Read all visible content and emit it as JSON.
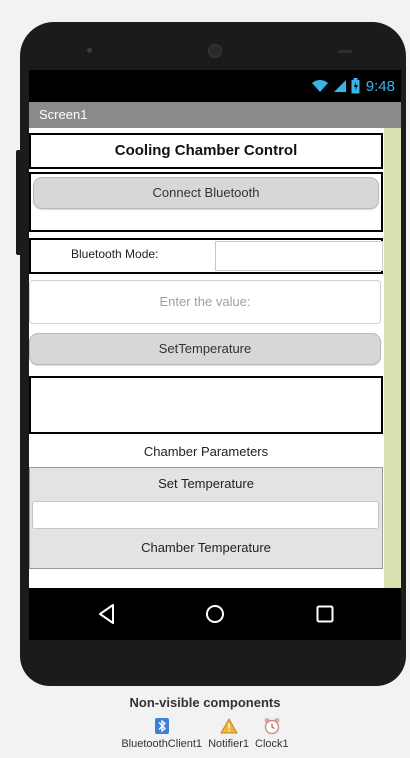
{
  "status_bar": {
    "time": "9:48",
    "icons": [
      "wifi-icon",
      "signal-icon",
      "battery-icon"
    ]
  },
  "screen": {
    "title": "Screen1"
  },
  "main": {
    "title": "Cooling Chamber Control",
    "connect_button": "Connect Bluetooth",
    "mode_label": "Bluetooth Mode:",
    "mode_value": "",
    "value_placeholder": "Enter the value:",
    "set_temperature_button": "SetTemperature",
    "params_label": "Chamber Parameters",
    "set_temperature_label": "Set Temperature",
    "set_temperature_value": "",
    "chamber_temperature_label": "Chamber Temperature"
  },
  "nav": {
    "icons": [
      "back-icon",
      "home-icon",
      "recents-icon"
    ]
  },
  "non_visible": {
    "title": "Non-visible components",
    "items": [
      {
        "label": "BluetoothClient1",
        "icon": "bluetooth-icon"
      },
      {
        "label": "Notifier1",
        "icon": "warning-icon"
      },
      {
        "label": "Clock1",
        "icon": "alarm-clock-icon"
      }
    ]
  },
  "colors": {
    "accent": "#39b6e6",
    "title_bar": "#8a8a8a",
    "strip": "#d8e2b0"
  }
}
